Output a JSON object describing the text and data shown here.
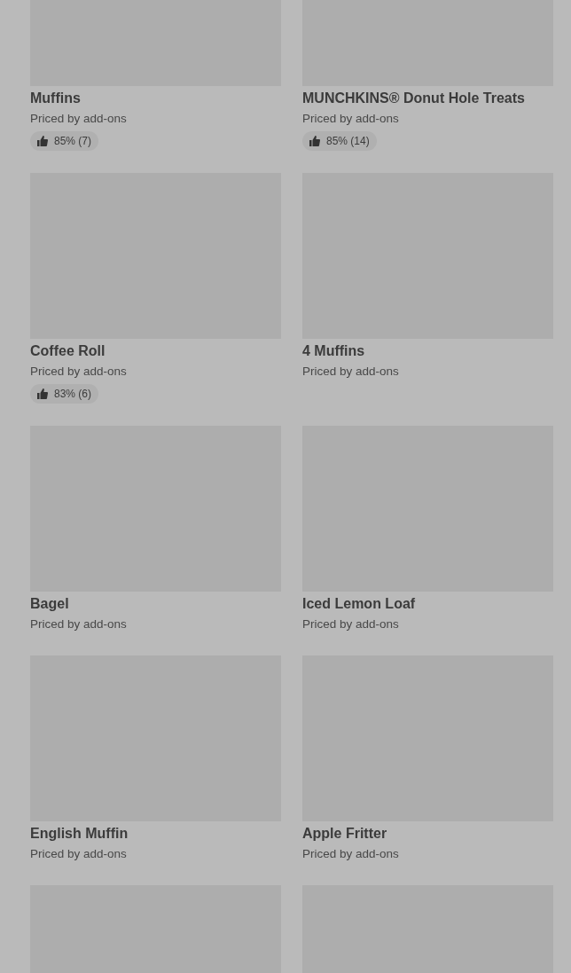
{
  "items": [
    {
      "kind": "product",
      "name": "Muffins",
      "subtitle": "Priced by add-ons",
      "rating": "85% (7)"
    },
    {
      "kind": "product",
      "name": "MUNCHKINS® Donut Hole Treats",
      "subtitle": "Priced by add-ons",
      "rating": "85% (14)"
    },
    {
      "kind": "product",
      "name": "Coffee Roll",
      "subtitle": "Priced by add-ons",
      "rating": "83% (6)"
    },
    {
      "kind": "product",
      "name": "4 Muffins",
      "subtitle": "Priced by add-ons"
    },
    {
      "kind": "product",
      "name": "Bagel",
      "subtitle": "Priced by add-ons"
    },
    {
      "kind": "product",
      "name": "Iced Lemon Loaf",
      "subtitle": "Priced by add-ons"
    },
    {
      "kind": "product",
      "name": "English Muffin",
      "subtitle": "Priced by add-ons"
    },
    {
      "kind": "product",
      "name": "Apple Fritter",
      "subtitle": "Priced by add-ons"
    },
    {
      "kind": "image_only"
    },
    {
      "kind": "image_only"
    }
  ]
}
